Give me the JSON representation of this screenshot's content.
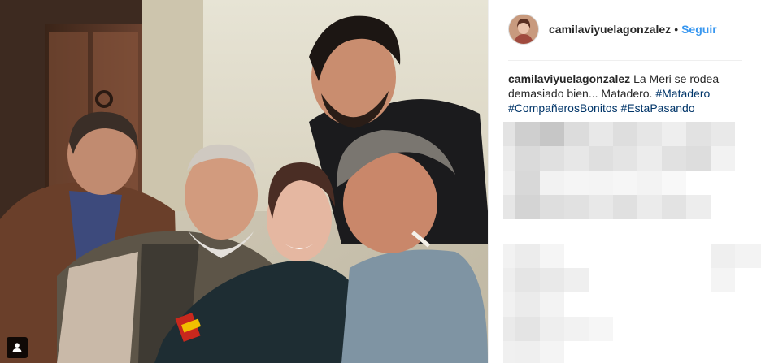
{
  "post": {
    "username": "camilaviyuelagonzalez",
    "separator": "•",
    "follow_label": "Seguir",
    "caption": {
      "username": "camilaviyuelagonzalez",
      "text": "La Meri se rodea demasiado bien... Matadero.",
      "hashtags": [
        "#Matadero",
        "#CompañerosBonitos",
        "#EstaPasando"
      ]
    },
    "photo_icon": "user-tag-icon",
    "comments_state": "pixelated"
  },
  "colors": {
    "accent": "#3897f0",
    "hashtag": "#003569",
    "text": "#262626",
    "divider": "#efefef"
  }
}
